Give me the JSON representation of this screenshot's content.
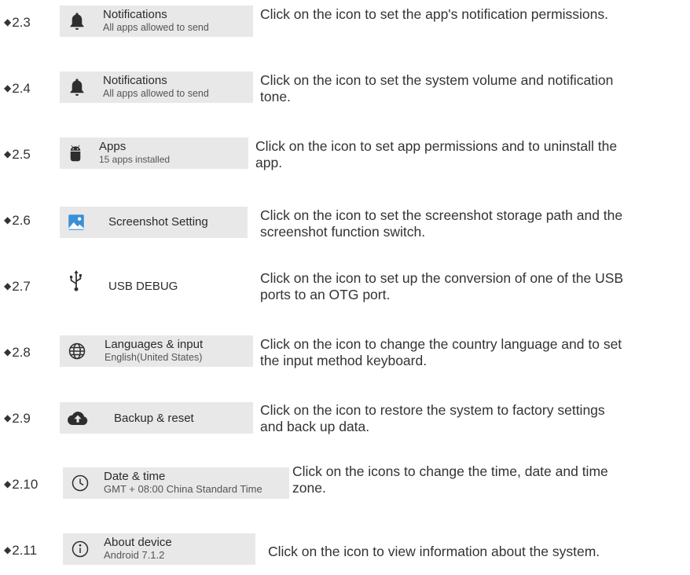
{
  "items": [
    {
      "number": "2.3",
      "icon": "bell-icon",
      "title": "Notifications",
      "subtitle": "All apps allowed to send",
      "description": "Click on the icon to set the app's notification permissions."
    },
    {
      "number": "2.4",
      "icon": "bell-icon",
      "title": "Notifications",
      "subtitle": "All apps allowed to send",
      "description": "Click on the icon to set the system volume and notification tone."
    },
    {
      "number": "2.5",
      "icon": "android-icon",
      "title": "Apps",
      "subtitle": "15 apps installed",
      "description": "Click on the icon to set app permissions and to uninstall the app."
    },
    {
      "number": "2.6",
      "icon": "image-icon",
      "title": "Screenshot Setting",
      "description": "Click on the icon to set the screenshot storage path and the screenshot function switch."
    },
    {
      "number": "2.7",
      "icon": "usb-icon",
      "title": "USB DEBUG",
      "description": "Click on the icon to set up the conversion of one of the USB ports to an OTG port."
    },
    {
      "number": "2.8",
      "icon": "globe-icon",
      "title": "Languages & input",
      "subtitle": "English(United States)",
      "description": "Click on the icon to change the country language and to set the input method keyboard."
    },
    {
      "number": "2.9",
      "icon": "cloud-upload-icon",
      "title": "Backup & reset",
      "description": "Click on the icon to restore the system to factory settings and back up data."
    },
    {
      "number": "2.10",
      "icon": "clock-icon",
      "title": "Date & time",
      "subtitle": "GMT + 08:00 China Standard Time",
      "description": "Click on the icons to change the time, date and time zone."
    },
    {
      "number": "2.11",
      "icon": "info-icon",
      "title": "About device",
      "subtitle": "Android 7.1.2",
      "description": "Click on the icon to view information about the system."
    }
  ]
}
